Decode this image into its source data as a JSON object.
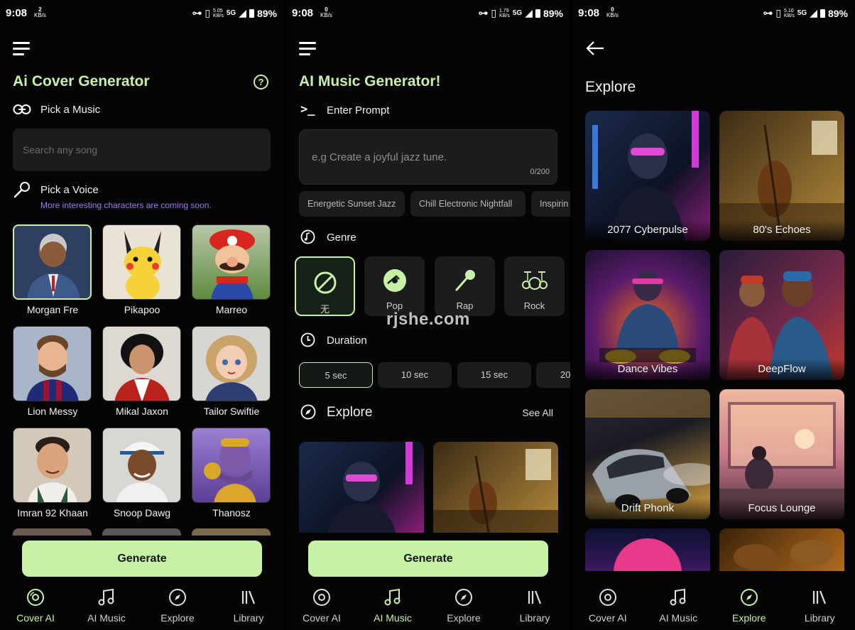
{
  "status_bars": [
    {
      "time": "9:08",
      "net_value": "2",
      "net_unit": "KB/s",
      "speed": "5.05",
      "speed_unit": "KB/s",
      "network": "5G",
      "battery": "89%"
    },
    {
      "time": "9:08",
      "net_value": "0",
      "net_unit": "KB/s",
      "speed": "1.79",
      "speed_unit": "KB/s",
      "network": "5G",
      "battery": "89%"
    },
    {
      "time": "9:08",
      "net_value": "0",
      "net_unit": "KB/s",
      "speed": "5.10",
      "speed_unit": "KB/s",
      "network": "5G",
      "battery": "89%"
    }
  ],
  "cover": {
    "title": "Ai Cover Generator",
    "help_icon": "question-circle-icon",
    "pick_music_label": "Pick a Music",
    "search_placeholder": "Search any song",
    "pick_voice_label": "Pick a Voice",
    "voice_subtitle": "More interesting characters are coming soon.",
    "voices": [
      {
        "name": "Morgan Fre",
        "selected": true,
        "bg": "#3a4a63"
      },
      {
        "name": "Pikapoo",
        "selected": false,
        "bg": "#e9e3d6"
      },
      {
        "name": "Marreo",
        "selected": false,
        "bg": "#6c8a55"
      },
      {
        "name": "Lion Messy",
        "selected": false,
        "bg": "#a9b6c8"
      },
      {
        "name": "Mikal Jaxon",
        "selected": false,
        "bg": "#ddd9d2"
      },
      {
        "name": "Tailor Swiftie",
        "selected": false,
        "bg": "#d8d6d2"
      },
      {
        "name": "Imran 92 Khaan",
        "selected": false,
        "bg": "#d3c9b9"
      },
      {
        "name": "Snoop Dawg",
        "selected": false,
        "bg": "#d9d7d3"
      },
      {
        "name": "Thanosz",
        "selected": false,
        "bg": "#7a5fb0"
      }
    ],
    "generate_label": "Generate"
  },
  "music": {
    "title": "AI Music Generator!",
    "prompt_label": "Enter Prompt",
    "prompt_placeholder": "e.g Create a joyful jazz tune.",
    "prompt_count": "0/200",
    "chips": [
      "Energetic Sunset Jazz",
      "Chill Electronic Nightfall",
      "Inspirin"
    ],
    "genre_label": "Genre",
    "genres": [
      {
        "label": "无",
        "icon": "no-symbol-icon",
        "selected": true
      },
      {
        "label": "Pop",
        "icon": "vinyl-icon",
        "selected": false
      },
      {
        "label": "Rap",
        "icon": "microphone-icon",
        "selected": false
      },
      {
        "label": "Rock",
        "icon": "drum-kit-icon",
        "selected": false
      }
    ],
    "duration_label": "Duration",
    "durations": [
      {
        "label": "5 sec",
        "selected": true
      },
      {
        "label": "10 sec",
        "selected": false
      },
      {
        "label": "15 sec",
        "selected": false
      },
      {
        "label": "20",
        "selected": false
      }
    ],
    "explore_label": "Explore",
    "see_all_label": "See All",
    "generate_label": "Generate"
  },
  "explore": {
    "title": "Explore",
    "items": [
      {
        "name": "2077 Cyberpulse",
        "c1": "#1b2a4a",
        "c2": "#8a1f7a"
      },
      {
        "name": "80's Echoes",
        "c1": "#3b2a14",
        "c2": "#b48a3c"
      },
      {
        "name": "Dance Vibes",
        "c1": "#1a1230",
        "c2": "#e86a1f"
      },
      {
        "name": "DeepFlow",
        "c1": "#2a1c3a",
        "c2": "#c0392b"
      },
      {
        "name": "Drift Phonk",
        "c1": "#1a1a22",
        "c2": "#d9a441"
      },
      {
        "name": "Focus Lounge",
        "c1": "#4a2a3a",
        "c2": "#e9a58a"
      },
      {
        "name": "",
        "c1": "#0c1030",
        "c2": "#e83a8a"
      },
      {
        "name": "",
        "c1": "#3a2208",
        "c2": "#b26a1e"
      }
    ]
  },
  "nav": {
    "items": [
      {
        "label": "Cover AI",
        "icon": "disc-icon"
      },
      {
        "label": "AI Music",
        "icon": "music-note-icon"
      },
      {
        "label": "Explore",
        "icon": "compass-icon"
      },
      {
        "label": "Library",
        "icon": "library-icon"
      }
    ],
    "active_per_screen": [
      0,
      1,
      2
    ]
  },
  "watermark": "rjshe.com",
  "colors": {
    "accent": "#c7f2a6",
    "purple": "#a277f5",
    "surface": "#1c1c1e"
  }
}
